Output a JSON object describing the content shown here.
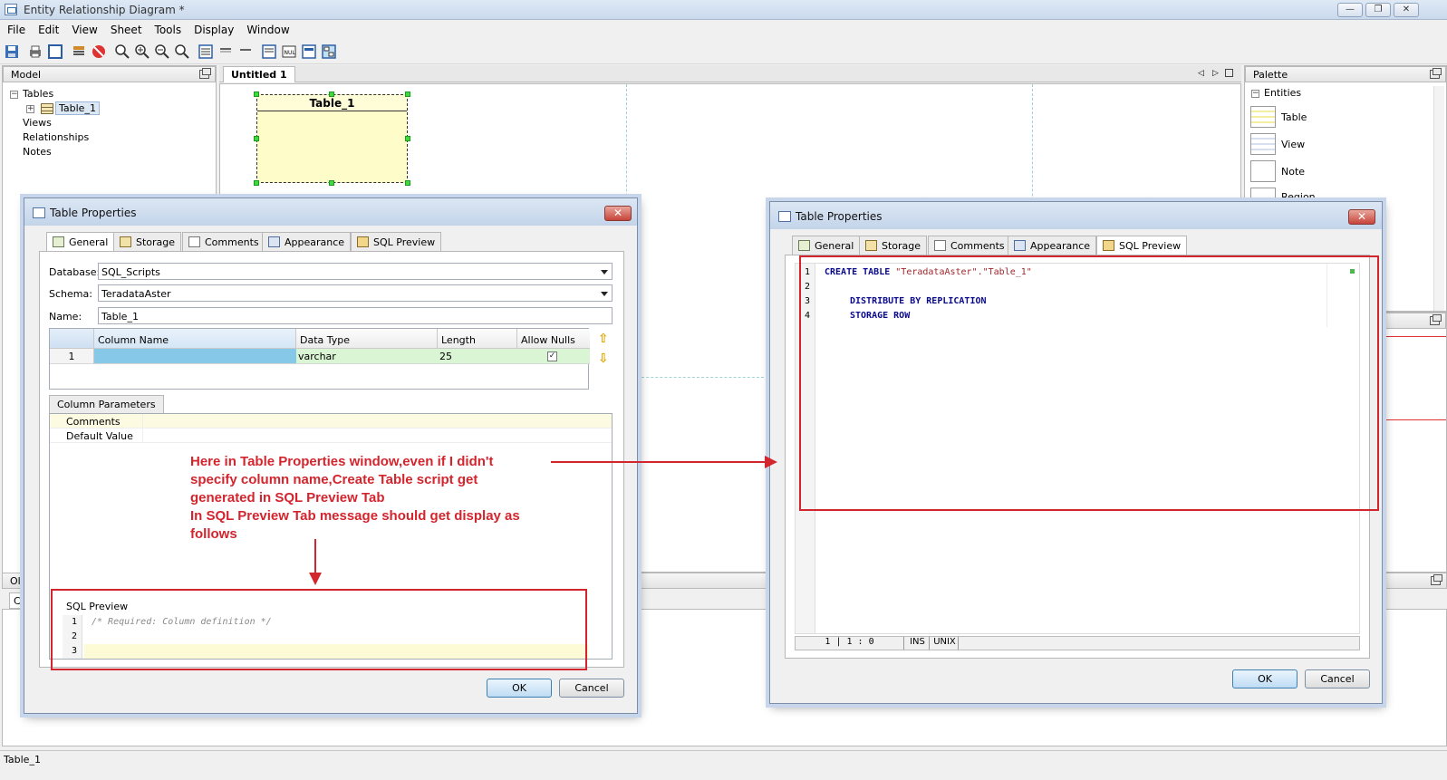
{
  "window": {
    "title": "Entity Relationship Diagram *"
  },
  "menu": [
    "File",
    "Edit",
    "View",
    "Sheet",
    "Tools",
    "Display",
    "Window"
  ],
  "model_panel": {
    "title": "Model",
    "tree": {
      "tables": "Tables",
      "table1": "Table_1",
      "views": "Views",
      "relationships": "Relationships",
      "notes": "Notes"
    }
  },
  "editor": {
    "tab": "Untitled 1",
    "entity_title": "Table_1"
  },
  "palette": {
    "title": "Palette",
    "section": "Entities",
    "items": [
      "Table",
      "View",
      "Note",
      "Region"
    ]
  },
  "bottom": {
    "tab1": "Ol",
    "tab2": "Co"
  },
  "status": {
    "text": "Table_1"
  },
  "dialog_left": {
    "title": "Table Properties",
    "tabs": [
      "General",
      "Storage",
      "Comments",
      "Appearance",
      "SQL Preview"
    ],
    "labels": {
      "database": "Database:",
      "schema": "Schema:",
      "name": "Name:"
    },
    "values": {
      "database": "SQL_Scripts",
      "schema": "TeradataAster",
      "name": "Table_1"
    },
    "grid": {
      "headers": [
        "Column Name",
        "Data Type",
        "Length",
        "Allow Nulls"
      ],
      "row": {
        "num": "1",
        "column_name": "",
        "data_type": "varchar",
        "length": "25",
        "allow_nulls": "✓"
      }
    },
    "params": {
      "tab": "Column Parameters",
      "rows": [
        "Comments",
        "Default Value"
      ]
    },
    "sql_preview": {
      "label": "SQL Preview",
      "lines": [
        {
          "n": "1",
          "text": "/* Required: Column definition */"
        },
        {
          "n": "2",
          "text": ""
        },
        {
          "n": "3",
          "text": ""
        }
      ]
    },
    "ok": "OK",
    "cancel": "Cancel"
  },
  "dialog_right": {
    "title": "Table Properties",
    "tabs": [
      "General",
      "Storage",
      "Comments",
      "Appearance",
      "SQL Preview"
    ],
    "sql": {
      "line1": {
        "n": "1",
        "kw": "CREATE TABLE",
        "str": "\"TeradataAster\".\"Table_1\""
      },
      "line2": {
        "n": "2",
        "text": ""
      },
      "line3": {
        "n": "3",
        "text": "DISTRIBUTE BY REPLICATION"
      },
      "line4": {
        "n": "4",
        "text": "STORAGE ROW"
      }
    },
    "status": {
      "pos": "1 | 1 : 0",
      "ins": "INS",
      "eol": "UNIX"
    },
    "ok": "OK",
    "cancel": "Cancel"
  },
  "annotation": {
    "lines": [
      "Here in Table Properties window,even if I didn't",
      "specify column name,Create Table script get",
      "generated in SQL Preview Tab",
      "In SQL Preview Tab message should get display as",
      "follows"
    ],
    "color": "#d3252e"
  }
}
